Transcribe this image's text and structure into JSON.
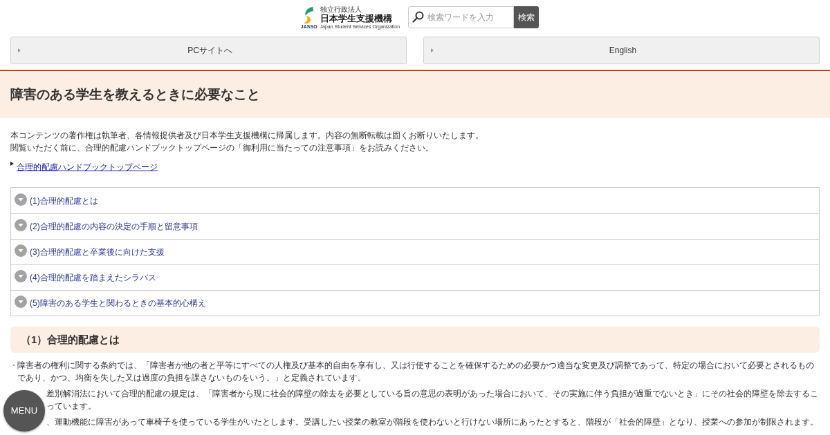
{
  "header": {
    "logo": {
      "abbreviation": "JASSO",
      "agency_type": "独立行政法人",
      "name": "日本学生支援機構",
      "english_name": "Japan Student Services Organization"
    },
    "search": {
      "placeholder": "検索ワードを入力",
      "button": "検索"
    }
  },
  "site_links": [
    {
      "label": "PCサイトへ"
    },
    {
      "label": "English"
    }
  ],
  "page_title": "障害のある学生を教えるときに必要なこと",
  "notice": [
    "本コンテンツの著作権は執筆者、各情報提供者及び日本学生支援機構に帰属します。内容の無断転載は固くお断りいたします。",
    "閲覧いただく前に、合理的配慮ハンドブックトップページの「御利用に当たっての注意事項」をお読みください。"
  ],
  "links": [
    "合理的配慮ハンドブックトップページ"
  ],
  "contents": [
    {
      "label": "(1)合理的配慮とは"
    },
    {
      "label": "(2)合理的配慮の内容の決定の手順と留意事項"
    },
    {
      "label": "(3)合理的配慮と卒業後に向けた支援"
    },
    {
      "label": "(4)合理的配慮を踏まえたシラバス"
    },
    {
      "label": "(5)障害のある学生と関わるときの基本的心構え"
    }
  ],
  "section": {
    "heading": "（1）合理的配慮とは",
    "paragraphs": [
      {
        "kind": "full",
        "text": "障害者の権利に関する条約では、「障害者が他の者と平等にすべての人権及び基本的自由を享有し、又は行使することを確保するための必要かつ適当な変更及び調整であって、特定の場合において必要とされるものであり、かつ、均衡を失した又は過度の負担を課さないものをいう。」と定義されています。"
      },
      {
        "kind": "covered",
        "lines": [
          "差別解消法において合理的配慮の規定は、「障害者から現に社会的障壁の除去を必要としている旨の意思の表明があった場合において、その実施に伴う負担が過重でないとき」にその社会的障壁を除去するこ",
          "っています。"
        ]
      },
      {
        "kind": "covered",
        "lines": [
          "、運動機能に障害があって車椅子を使っている学生がいたとします。受講したい授業の教室が階段を使わないと行けない場所にあったとすると、階段が「社会的障壁」となり、授業への参加が制限されます。"
        ]
      }
    ]
  },
  "menu_button": "MENU"
}
